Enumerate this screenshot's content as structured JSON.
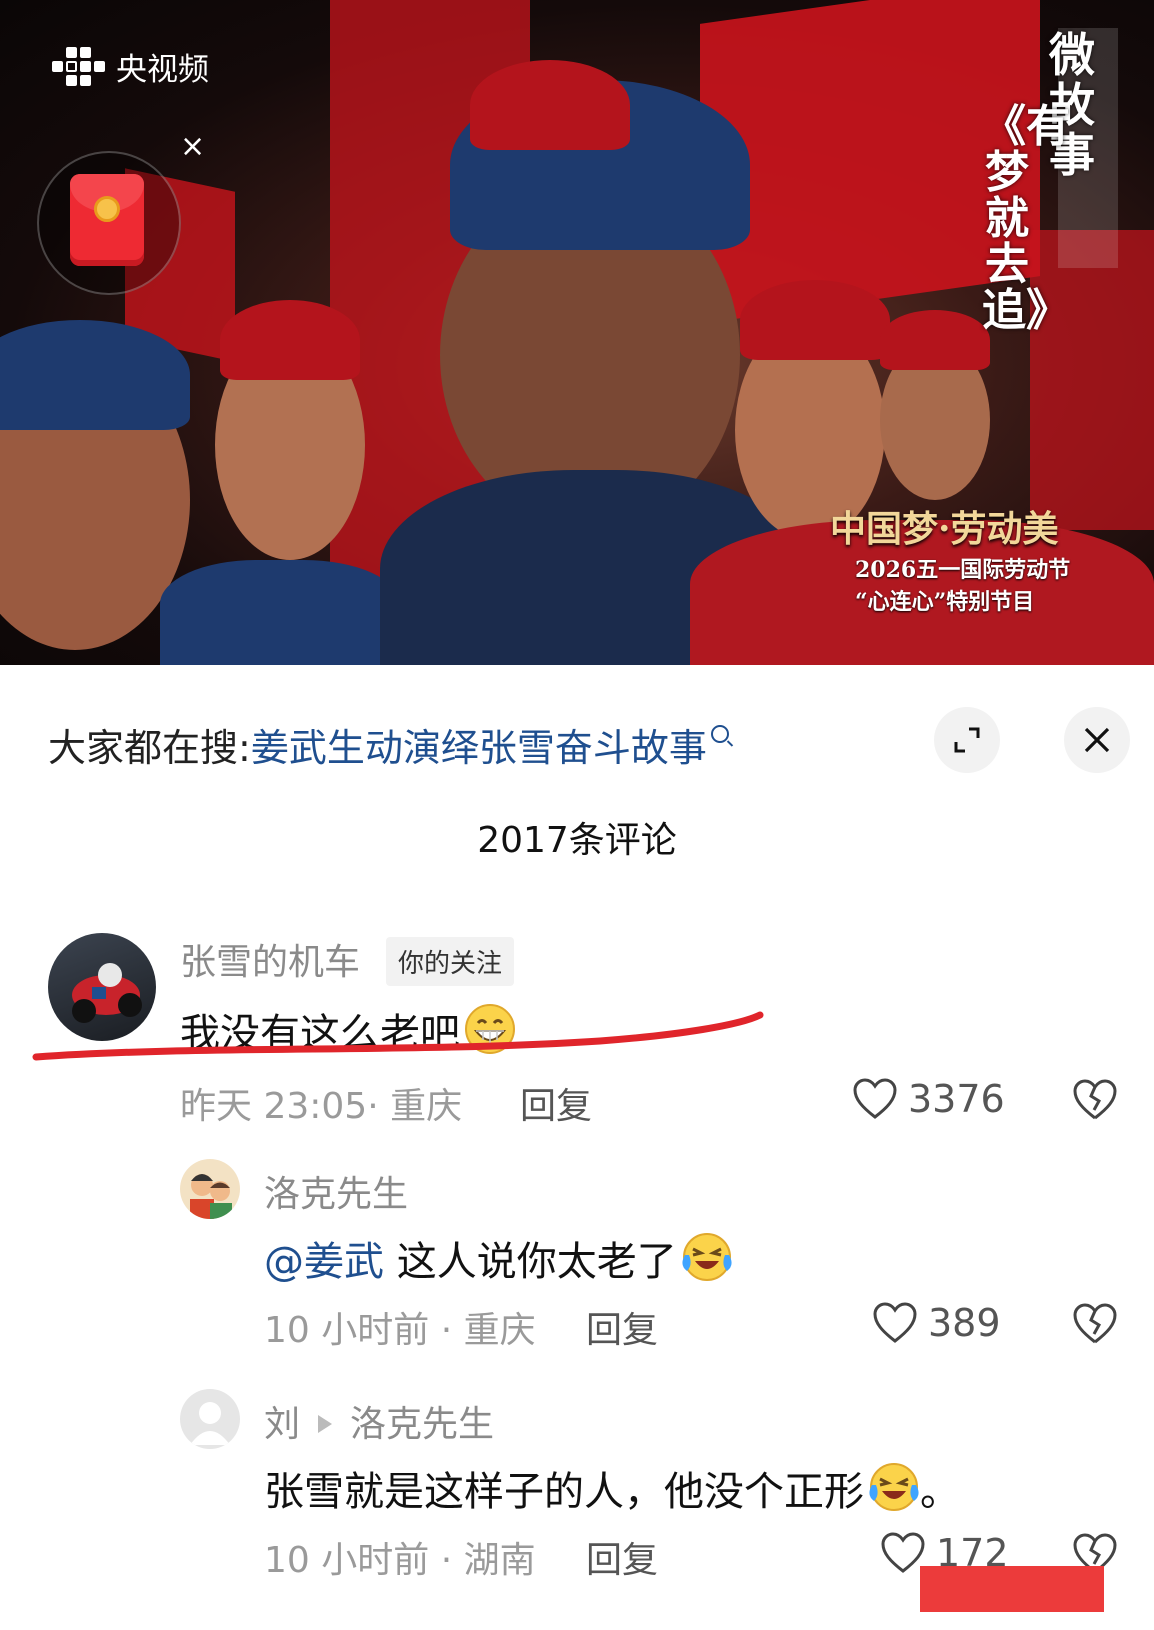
{
  "video": {
    "brand": "央视频",
    "close_label": "×",
    "side_badge": "微故事",
    "vertical_title": "《有梦就去追》",
    "event_title": "中国梦·劳动美",
    "event_sub1": "2026五一国际劳动节",
    "event_sub2": "“心连心”特别节目"
  },
  "search": {
    "prefix": "大家都在搜:",
    "term": "姜武生动演绎张雪奋斗故事"
  },
  "comments_title": "2017条评论",
  "comments": [
    {
      "name": "张雪的机车",
      "tag": "你的关注",
      "text": "我没有这么老吧",
      "time_loc": "昨天 23:05· 重庆",
      "reply": "回复",
      "likes": "3376"
    },
    {
      "name": "洛克先生",
      "mention": "@姜武",
      "text": " 这人说你太老了",
      "time_loc": "10 小时前 · 重庆",
      "reply": "回复",
      "likes": "389"
    },
    {
      "name": "刘",
      "reply_to": "洛克先生",
      "text": "张雪就是这样子的人，他没个正形",
      "text_end": "。",
      "time_loc": "10 小时前 · 湖南",
      "reply": "回复",
      "likes": "172"
    }
  ],
  "colors": {
    "accent": "#1f4f8f",
    "annotation": "#e0252b",
    "redaction": "#ec3b3b"
  },
  "icons": [
    "brand-logo-icon",
    "red-packet-icon",
    "search-icon",
    "expand-icon",
    "close-icon",
    "heart-icon",
    "broken-heart-icon",
    "grin-emoji-icon",
    "laugh-cry-emoji-icon",
    "default-avatar-icon"
  ]
}
